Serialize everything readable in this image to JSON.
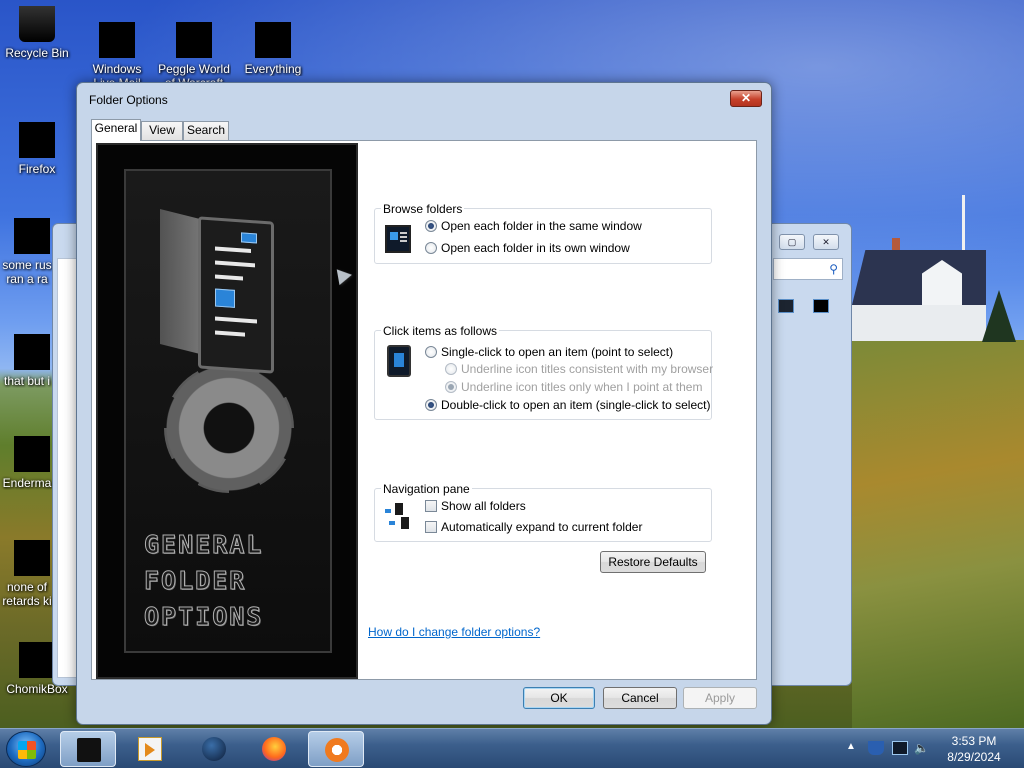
{
  "desktop": {
    "icons": [
      {
        "label": "Recycle Bin",
        "icon": "recycle-bin-icon"
      },
      {
        "label": "Windows Live Mail",
        "icon": "redacted-icon"
      },
      {
        "label": "Peggle World of Warcraft",
        "icon": "redacted-icon"
      },
      {
        "label": "Everything",
        "icon": "redacted-icon"
      },
      {
        "label": "Firefox",
        "icon": "firefox-icon"
      },
      {
        "label": "some rus ran a ra",
        "icon": "redacted-icon"
      },
      {
        "label": "that but i",
        "icon": "redacted-icon"
      },
      {
        "label": "Enderma",
        "icon": "redacted-icon"
      },
      {
        "label": "none of retards ki",
        "icon": "redacted-icon"
      },
      {
        "label": "ChomikBox",
        "icon": "redacted-icon"
      }
    ]
  },
  "background_window": {
    "search_icon": "magnifier-icon"
  },
  "dialog": {
    "title": "Folder Options",
    "close_label": "✕",
    "tabs": [
      {
        "label": "General",
        "active": true
      },
      {
        "label": "View",
        "active": false
      },
      {
        "label": "Search",
        "active": false
      }
    ],
    "art_caption": "GENERAL FOLDER OPTIONS",
    "browse_folders": {
      "title": "Browse folders",
      "options": [
        {
          "label": "Open each folder in the same window",
          "selected": true
        },
        {
          "label": "Open each folder in its own window",
          "selected": false
        }
      ]
    },
    "click_items": {
      "title": "Click items as follows",
      "options": [
        {
          "label": "Single-click to open an item (point to select)",
          "selected": false,
          "enabled": true
        },
        {
          "label": "Underline icon titles consistent with my browser",
          "selected": false,
          "enabled": false
        },
        {
          "label": "Underline icon titles only when I point at them",
          "selected": true,
          "enabled": false
        },
        {
          "label": "Double-click to open an item (single-click to select)",
          "selected": true,
          "enabled": true
        }
      ]
    },
    "navigation_pane": {
      "title": "Navigation pane",
      "options": [
        {
          "label": "Show all folders",
          "checked": false
        },
        {
          "label": "Automatically expand to current folder",
          "checked": false
        }
      ]
    },
    "restore_defaults": "Restore Defaults",
    "help_link": "How do I change folder options?",
    "buttons": {
      "ok": "OK",
      "cancel": "Cancel",
      "apply": "Apply"
    }
  },
  "taskbar": {
    "time": "3:53 PM",
    "date": "8/29/2024"
  }
}
